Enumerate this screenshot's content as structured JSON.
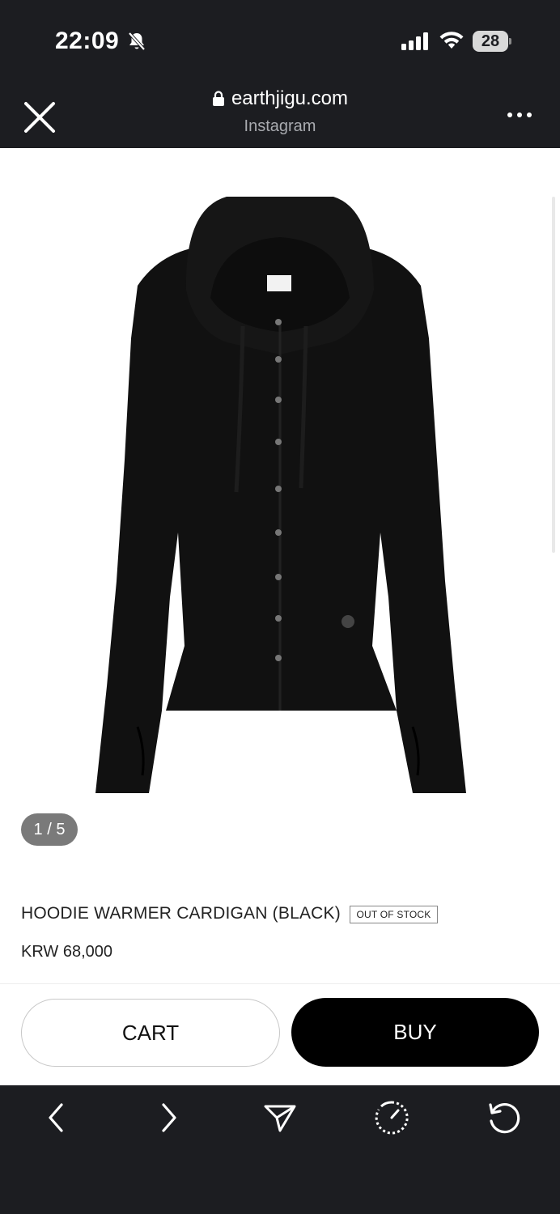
{
  "status_bar": {
    "time": "22:09",
    "battery": "28"
  },
  "browser": {
    "url": "earthjigu.com",
    "source": "Instagram"
  },
  "gallery": {
    "pager": "1 / 5"
  },
  "product": {
    "title": "HOODIE WARMER CARDIGAN (BLACK)",
    "stock_badge": "OUT OF STOCK",
    "price": "KRW 68,000"
  },
  "actions": {
    "cart_label": "CART",
    "buy_label": "BUY"
  },
  "icons": {
    "bottom_nav": [
      "back-arrow-icon",
      "forward-arrow-icon",
      "share-icon",
      "timer-icon",
      "reload-icon"
    ]
  },
  "colors": {
    "chrome_bg": "#1c1d21",
    "buy_button": "#000000",
    "pager_badge": "#7a7a7a"
  }
}
